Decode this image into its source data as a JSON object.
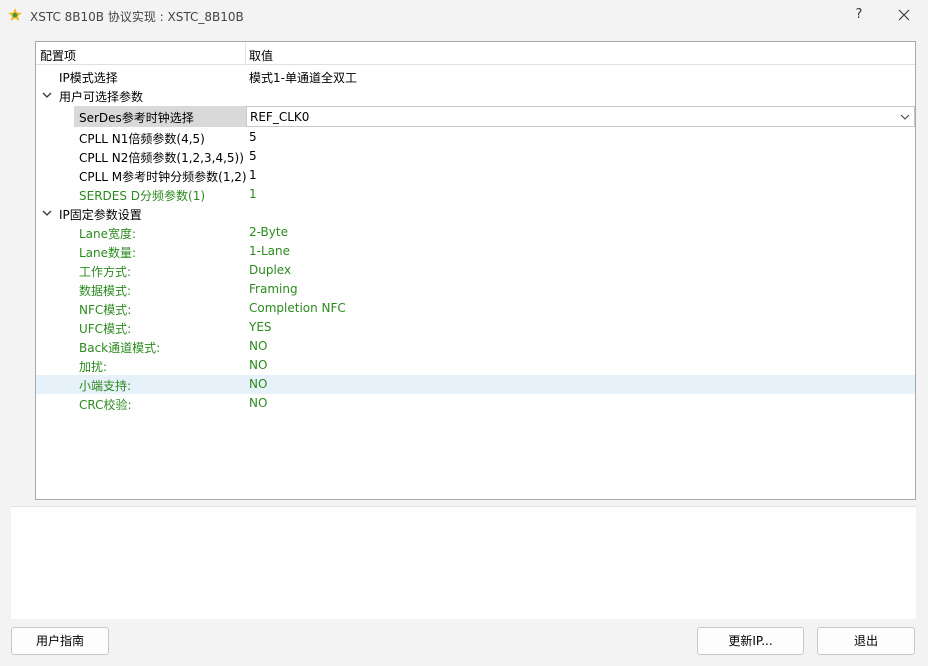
{
  "window": {
    "title": "XSTC 8B10B 协议实现 : XSTC_8B10B",
    "help_label": "?"
  },
  "table": {
    "headers": [
      "配置项",
      "取值"
    ],
    "rows": [
      {
        "label": "IP模式选择",
        "value": "模式1-单通道全双工"
      },
      {
        "label": "用户可选择参数",
        "value": ""
      },
      {
        "label": "SerDes参考时钟选择",
        "value": "REF_CLK0"
      },
      {
        "label": "CPLL N1倍频参数(4,5)",
        "value": "5"
      },
      {
        "label": "CPLL N2倍频参数(1,2,3,4,5))",
        "value": "5"
      },
      {
        "label": "CPLL M参考时钟分频参数(1,2)",
        "value": "1"
      },
      {
        "label": "SERDES D分频参数(1)",
        "value": "1"
      },
      {
        "label": "IP固定参数设置",
        "value": ""
      },
      {
        "label": "Lane宽度:",
        "value": "2-Byte"
      },
      {
        "label": "Lane数量:",
        "value": "1-Lane"
      },
      {
        "label": "工作方式:",
        "value": "Duplex"
      },
      {
        "label": "数据模式:",
        "value": "Framing"
      },
      {
        "label": "NFC模式:",
        "value": "Completion NFC"
      },
      {
        "label": "UFC模式:",
        "value": "YES"
      },
      {
        "label": "Back通道模式:",
        "value": "NO"
      },
      {
        "label": "加扰:",
        "value": "NO"
      },
      {
        "label": "小端支持:",
        "value": "NO"
      },
      {
        "label": "CRC校验:",
        "value": "NO"
      }
    ]
  },
  "buttons": {
    "user_guide": "用户指南",
    "update_ip": "更新IP...",
    "exit": "退出"
  },
  "colors": {
    "readonly_text": "#2b8a1e",
    "highlight_row": "#e6f1fa",
    "selected_label": "#d9d9d9"
  }
}
